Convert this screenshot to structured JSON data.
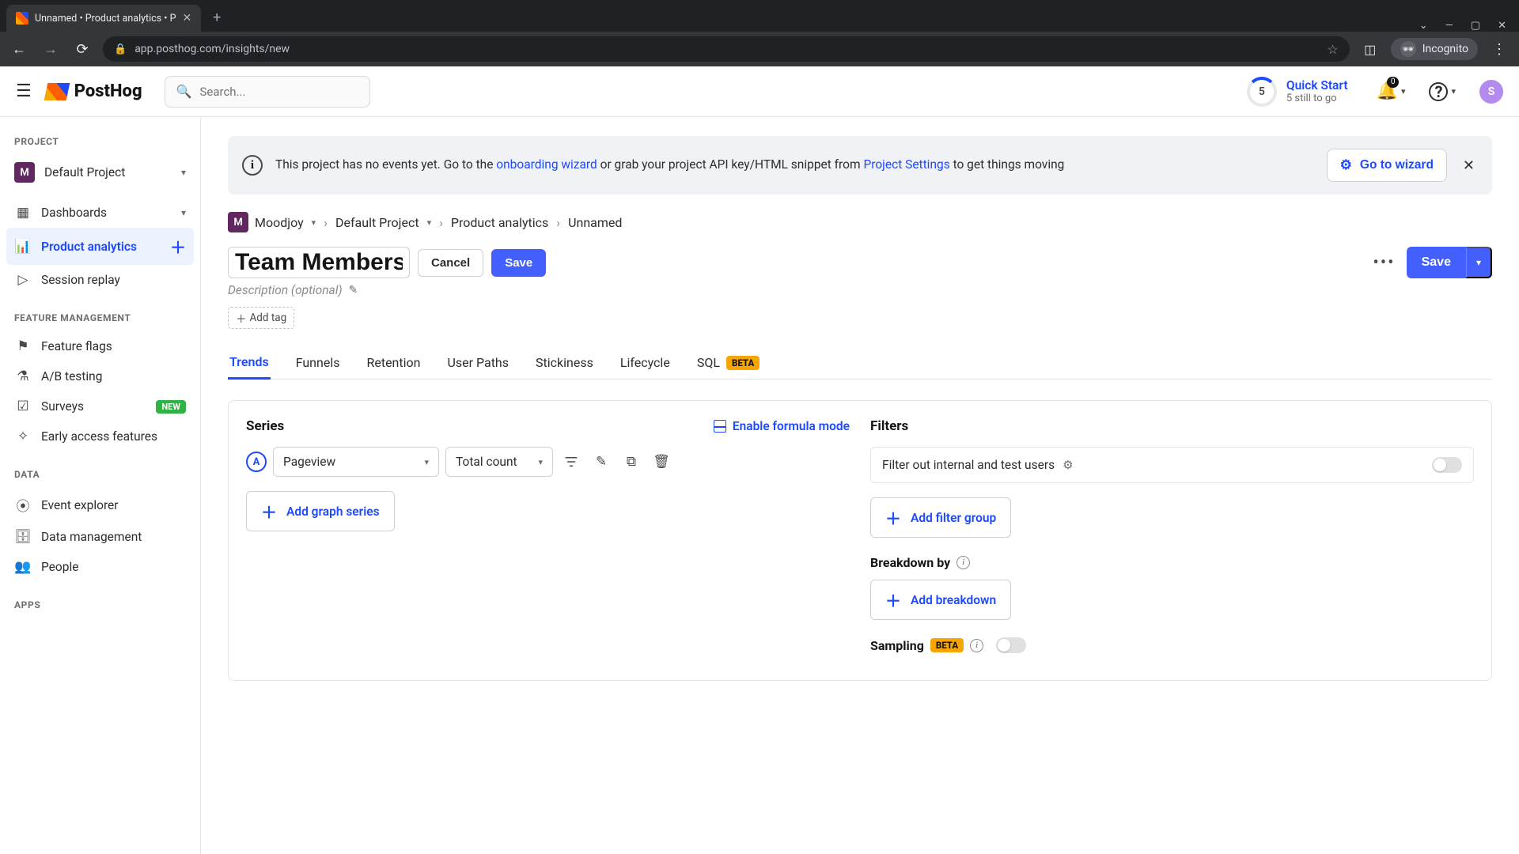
{
  "browser": {
    "tab_title": "Unnamed • Product analytics • P",
    "url": "app.posthog.com/insights/new",
    "newtab": "+",
    "window": {
      "min": "—",
      "max": "▢",
      "close": "✕",
      "chev": "⌄"
    },
    "incognito_label": "Incognito"
  },
  "topbar": {
    "brand": "PostHog",
    "search_placeholder": "Search...",
    "quick_start_title": "Quick Start",
    "quick_start_sub": "5 still to go",
    "quick_start_count": "5",
    "bell_badge": "0",
    "help": "?",
    "avatar_initial": "S"
  },
  "sidebar": {
    "sections": {
      "project": "PROJECT",
      "feature": "FEATURE MANAGEMENT",
      "data": "DATA",
      "apps": "APPS"
    },
    "project_item": {
      "initial": "M",
      "label": "Default Project"
    },
    "items": {
      "dashboards": "Dashboards",
      "product_analytics": "Product analytics",
      "session_replay": "Session replay",
      "feature_flags": "Feature flags",
      "ab_testing": "A/B testing",
      "surveys": "Surveys",
      "surveys_badge": "NEW",
      "early_access": "Early access features",
      "event_explorer": "Event explorer",
      "data_management": "Data management",
      "people": "People"
    }
  },
  "banner": {
    "text1": "This project has no events yet. Go to the ",
    "link1": "onboarding wizard",
    "text2": " or grab your project API key/HTML snippet from ",
    "link2": "Project Settings",
    "text3": " to get things moving",
    "cta": "Go to wizard"
  },
  "breadcrumb": {
    "org_initial": "M",
    "org": "Moodjoy",
    "project": "Default Project",
    "section": "Product analytics",
    "current": "Unnamed"
  },
  "title": {
    "value": "Team Members",
    "cancel": "Cancel",
    "save_inline": "Save",
    "save_main": "Save"
  },
  "description": {
    "placeholder": "Description (optional)"
  },
  "tag_add": "Add tag",
  "tabs": {
    "trends": "Trends",
    "funnels": "Funnels",
    "retention": "Retention",
    "paths": "User Paths",
    "stickiness": "Stickiness",
    "lifecycle": "Lifecycle",
    "sql": "SQL",
    "sql_badge": "BETA"
  },
  "builder": {
    "series": "Series",
    "formula": "Enable formula mode",
    "series_tag": "A",
    "event": "Pageview",
    "aggregation": "Total count",
    "add_series": "Add graph series",
    "filters": "Filters",
    "internal_filter": "Filter out internal and test users",
    "add_filter": "Add filter group",
    "breakdown": "Breakdown by",
    "add_breakdown": "Add breakdown",
    "sampling": "Sampling",
    "sampling_badge": "BETA"
  }
}
